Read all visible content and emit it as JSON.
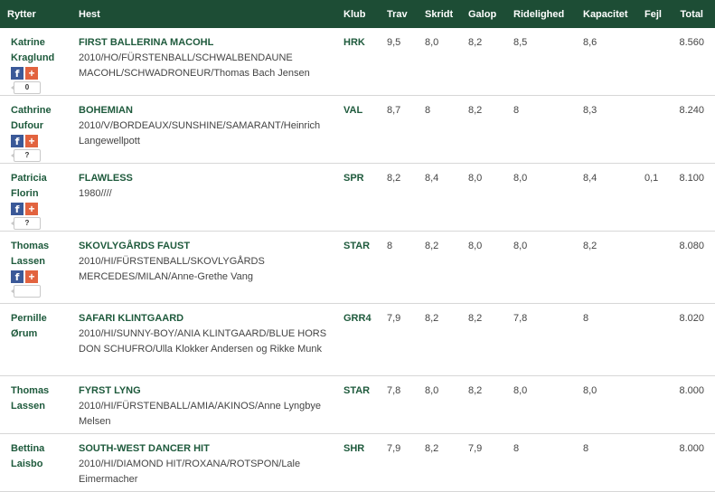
{
  "headers": {
    "rider": "Rytter",
    "horse": "Hest",
    "club": "Klub",
    "trav": "Trav",
    "skridt": "Skridt",
    "galop": "Galop",
    "ridelighed": "Ridelighed",
    "kapacitet": "Kapacitet",
    "fejl": "Fejl",
    "total": "Total"
  },
  "social": {
    "fb_icon": "facebook-icon",
    "plus_icon": "plus-icon"
  },
  "rows": [
    {
      "rider_first": "Katrine",
      "rider_last": "Kraglund",
      "share_count": "0",
      "has_social": true,
      "horse": "FIRST BALLERINA MACOHL",
      "info": "2010/HO/FÜRSTENBALL/SCHWALBENDAUNE MACOHL/SCHWADRONEUR/Thomas Bach Jensen",
      "club": "HRK",
      "trav": "9,5",
      "skridt": "8,0",
      "galop": "8,2",
      "ridelighed": "8,5",
      "kapacitet": "8,6",
      "fejl": "",
      "total": "8.560"
    },
    {
      "rider_first": "Cathrine",
      "rider_last": "Dufour",
      "share_count": "?",
      "has_social": true,
      "horse": "BOHEMIAN",
      "info": "2010/V/BORDEAUX/SUNSHINE/SAMARANT/Heinrich Langewellpott",
      "club": "VAL",
      "trav": "8,7",
      "skridt": "8",
      "galop": "8,2",
      "ridelighed": "8",
      "kapacitet": "8,3",
      "fejl": "",
      "total": "8.240"
    },
    {
      "rider_first": "Patricia",
      "rider_last": "Florin",
      "share_count": "?",
      "has_social": true,
      "horse": "FLAWLESS",
      "info": "1980////",
      "club": "SPR",
      "trav": "8,2",
      "skridt": "8,4",
      "galop": "8,0",
      "ridelighed": "8,0",
      "kapacitet": "8,4",
      "fejl": "0,1",
      "total": "8.100"
    },
    {
      "rider_first": "Thomas",
      "rider_last": "Lassen",
      "share_count": "",
      "has_social": true,
      "horse": "SKOVLYGÅRDS FAUST",
      "info": "2010/HI/FÜRSTENBALL/SKOVLYGÅRDS MERCEDES/MILAN/Anne-Grethe Vang",
      "club": "STAR",
      "trav": "8",
      "skridt": "8,2",
      "galop": "8,0",
      "ridelighed": "8,0",
      "kapacitet": "8,2",
      "fejl": "",
      "total": "8.080"
    },
    {
      "rider_first": "Pernille",
      "rider_last": "Ørum",
      "share_count": "",
      "has_social": false,
      "horse": "SAFARI KLINTGAARD",
      "info": "2010/HI/SUNNY-BOY/ANIA KLINTGAARD/BLUE HORS DON SCHUFRO/Ulla Klokker Andersen og Rikke Munk",
      "club": "GRR4",
      "trav": "7,9",
      "skridt": "8,2",
      "galop": "8,2",
      "ridelighed": "7,8",
      "kapacitet": "8",
      "fejl": "",
      "total": "8.020"
    },
    {
      "rider_first": "Thomas",
      "rider_last": "Lassen",
      "share_count": "",
      "has_social": false,
      "horse": "FYRST LYNG",
      "info": "2010/HI/FÜRSTENBALL/AMIA/AKINOS/Anne Lyngbye Melsen",
      "club": "STAR",
      "trav": "7,8",
      "skridt": "8,0",
      "galop": "8,2",
      "ridelighed": "8,0",
      "kapacitet": "8,0",
      "fejl": "",
      "total": "8.000"
    },
    {
      "rider_first": "Bettina",
      "rider_last": "Laisbo",
      "share_count": "",
      "has_social": false,
      "horse": "SOUTH-WEST DANCER HIT",
      "info": "2010/HI/DIAMOND HIT/ROXANA/ROTSPON/Lale Eimermacher",
      "club": "SHR",
      "trav": "7,9",
      "skridt": "8,2",
      "galop": "7,9",
      "ridelighed": "8",
      "kapacitet": "8",
      "fejl": "",
      "total": "8.000"
    }
  ]
}
